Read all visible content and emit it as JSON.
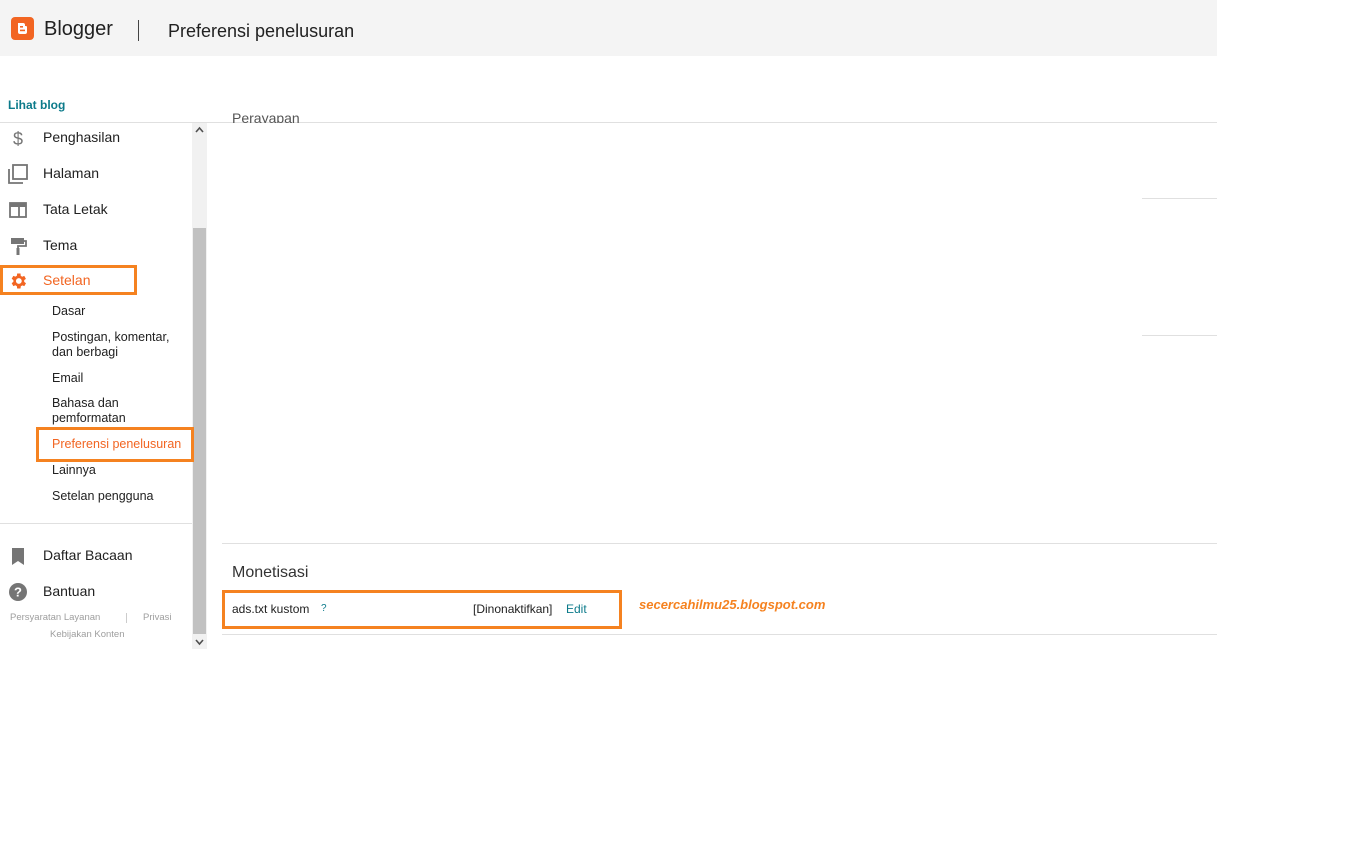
{
  "header": {
    "brand": "Blogger",
    "title": "Preferensi penelusuran"
  },
  "view_blog_label": "Lihat blog",
  "sidebar": {
    "items": [
      {
        "label": "Penghasilan",
        "icon": "dollar-icon"
      },
      {
        "label": "Halaman",
        "icon": "pages-icon"
      },
      {
        "label": "Tata Letak",
        "icon": "layout-icon"
      },
      {
        "label": "Tema",
        "icon": "paint-roller-icon"
      },
      {
        "label": "Setelan",
        "icon": "gear-icon",
        "active": true
      }
    ],
    "subitems": [
      {
        "label": "Dasar"
      },
      {
        "label": "Postingan, komentar, dan berbagi"
      },
      {
        "label": "Email"
      },
      {
        "label": "Bahasa dan pemformatan"
      },
      {
        "label": "Preferensi penelusuran",
        "active": true
      },
      {
        "label": "Lainnya"
      },
      {
        "label": "Setelan pengguna"
      }
    ],
    "bottom_items": [
      {
        "label": "Daftar Bacaan",
        "icon": "bookmark-icon"
      },
      {
        "label": "Bantuan",
        "icon": "help-icon"
      }
    ],
    "footer": {
      "terms": "Persyaratan Layanan",
      "privacy": "Privasi",
      "content_policy": "Kebijakan Konten"
    }
  },
  "main": {
    "cut_heading": "Perayapan",
    "monetization": {
      "title": "Monetisasi",
      "setting_label": "ads.txt kustom",
      "help": "?",
      "status": "[Dinonaktifkan]",
      "edit": "Edit"
    }
  },
  "watermark": "secercahilmu25.blogspot.com",
  "colors": {
    "accent": "#f26522",
    "link": "#0b7a8a",
    "annotation": "#f58220",
    "header_bg": "#f4f4f4"
  }
}
